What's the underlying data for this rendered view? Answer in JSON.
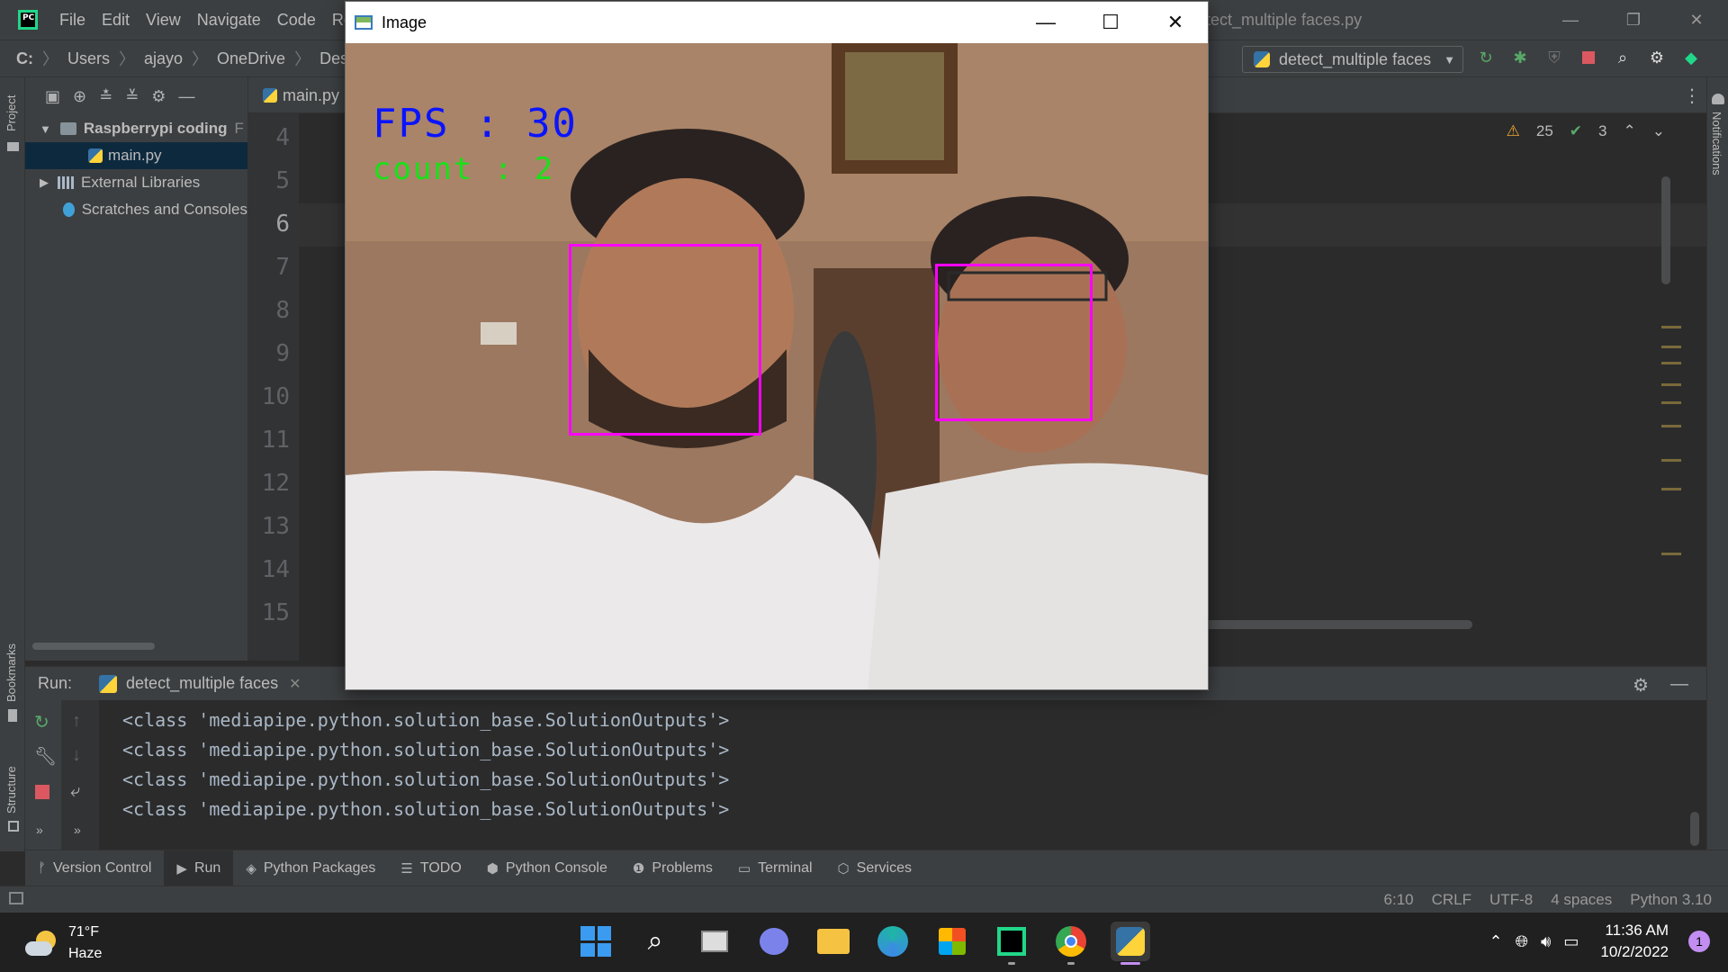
{
  "ide": {
    "menu": [
      "File",
      "Edit",
      "View",
      "Navigate",
      "Code",
      "Re"
    ],
    "window_title_fragment": "tect_multiple faces.py",
    "breadcrumbs": [
      "C:",
      "Users",
      "ajayo",
      "OneDrive",
      "Desktop"
    ],
    "run_config": "detect_multiple faces",
    "project_tab_label": "Project",
    "bookmarks_label": "Bookmarks",
    "structure_label": "Structure",
    "notifications_label": "Notifications"
  },
  "project_tree": {
    "root": "Raspberrypi coding",
    "root_suffix": "F",
    "file": "main.py",
    "external": "External Libraries",
    "scratches": "Scratches and Consoles"
  },
  "editor": {
    "tab": "main.py",
    "line_numbers": [
      "4",
      "5",
      "6",
      "7",
      "8",
      "9",
      "10",
      "11",
      "12",
      "13",
      "14",
      "15"
    ],
    "current_line": "6",
    "warnings": "25",
    "weak_warnings": "3"
  },
  "run_panel": {
    "label": "Run:",
    "tab": "detect_multiple faces",
    "output": [
      "<class 'mediapipe.python.solution_base.SolutionOutputs'>",
      "<class 'mediapipe.python.solution_base.SolutionOutputs'>",
      "<class 'mediapipe.python.solution_base.SolutionOutputs'>",
      "<class 'mediapipe.python.solution_base.SolutionOutputs'>"
    ]
  },
  "bottom_tabs": [
    "Version Control",
    "Run",
    "Python Packages",
    "TODO",
    "Python Console",
    "Problems",
    "Terminal",
    "Services"
  ],
  "status_bar": {
    "position": "6:10",
    "line_sep": "CRLF",
    "encoding": "UTF-8",
    "indent": "4 spaces",
    "interpreter": "Python 3.10"
  },
  "cv_window": {
    "title": "Image",
    "fps_text": "FPS : 30",
    "count_text": "count : 2",
    "box_color": "#ff00ff"
  },
  "taskbar": {
    "temp": "71°F",
    "condition": "Haze",
    "time": "11:36 AM",
    "date": "10/2/2022",
    "notifications": "1"
  }
}
